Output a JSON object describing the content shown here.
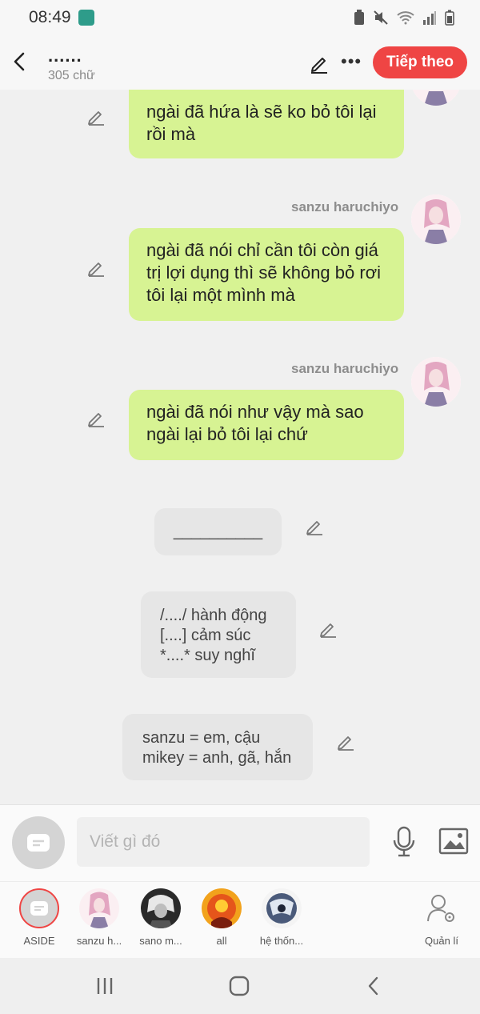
{
  "status": {
    "time": "08:49"
  },
  "header": {
    "title": "......",
    "word_count": "305 chữ",
    "next_label": "Tiếp theo"
  },
  "messages": [
    {
      "text": "ngài đã hứa là sẽ ko bỏ tôi lại rồi mà"
    },
    {
      "sender": "sanzu haruchiyo",
      "text": "ngài đã nói chỉ cần tôi còn giá trị lợi dụng thì sẽ không bỏ rơi tôi lại một mình mà"
    },
    {
      "sender": "sanzu haruchiyo",
      "text": "ngài đã nói như vậy mà sao ngài lại bỏ tôi lại chứ"
    }
  ],
  "notes": {
    "divider": "__________",
    "legend": [
      "/..../ hành động",
      "[....] cảm súc",
      "*....* suy nghĩ"
    ],
    "pronouns": [
      "sanzu = em, cậu",
      "mikey = anh, gã, hắn"
    ]
  },
  "input": {
    "placeholder": "Viết gì đó"
  },
  "characters": [
    {
      "name": "ASIDE"
    },
    {
      "name": "sanzu h..."
    },
    {
      "name": "sano m..."
    },
    {
      "name": "all"
    },
    {
      "name": "hệ thốn..."
    },
    {
      "name": "Quản lí"
    }
  ],
  "colors": {
    "accent": "#ef4544",
    "bubble_green": "#d7f393",
    "bubble_gray": "#e6e6e6"
  }
}
